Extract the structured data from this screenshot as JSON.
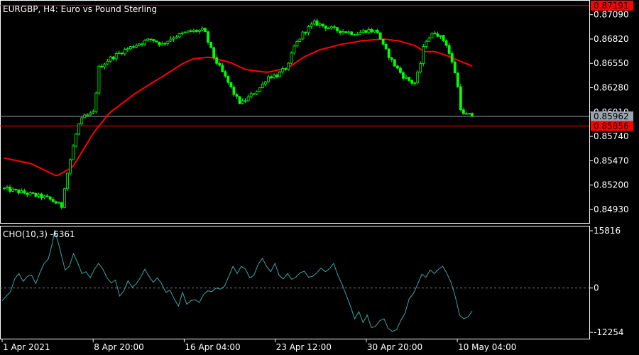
{
  "header": {
    "main_title": "EURGBP, H4:  Euro vs Pound Sterling",
    "indicator_title": "CHO(10,3) -6361"
  },
  "colors": {
    "background": "#000000",
    "bull_candle": "#00ff00",
    "bear_candle": "#00ff00",
    "moving_average": "#ff0000",
    "oscillator": "#3aa6a6",
    "axis_text": "#ffffff",
    "frame": "#ffffff",
    "price_line_bid": "#9aa4ae",
    "level_line": "#ff0000",
    "red_label_bg": "#ff0000",
    "gray_label_bg": "#9aa4ae",
    "zero_line": "#808080"
  },
  "chart_data": [
    {
      "type": "candlestick",
      "title": "EURGBP, H4:  Euro vs Pound Sterling",
      "ylim": [
        0.8478,
        0.87245
      ],
      "y_ticks": [
        "0.87090",
        "0.86820",
        "0.86550",
        "0.86280",
        "0.86010",
        "0.85740",
        "0.85470",
        "0.85200",
        "0.84930"
      ],
      "y_tick_values": [
        0.8709,
        0.8682,
        0.8655,
        0.8628,
        0.8601,
        0.8574,
        0.8547,
        0.852,
        0.8493
      ],
      "x_tick_labels": [
        "1 Apr 2021",
        "8 Apr 20:00",
        "16 Apr 04:00",
        "23 Apr 12:00",
        "30 Apr 20:00",
        "10 May 04:00"
      ],
      "bar_count": 164,
      "close_path": [
        [
          0,
          0.8516
        ],
        [
          8,
          0.8511
        ],
        [
          16,
          0.8506
        ],
        [
          20,
          0.85
        ],
        [
          22,
          0.8496
        ],
        [
          23,
          0.852
        ],
        [
          26,
          0.856
        ],
        [
          28,
          0.8585
        ],
        [
          30,
          0.8595
        ],
        [
          34,
          0.86
        ],
        [
          36,
          0.865
        ],
        [
          40,
          0.866
        ],
        [
          46,
          0.867
        ],
        [
          52,
          0.8678
        ],
        [
          56,
          0.8682
        ],
        [
          60,
          0.8676
        ],
        [
          64,
          0.8684
        ],
        [
          70,
          0.869
        ],
        [
          76,
          0.8692
        ],
        [
          78,
          0.8675
        ],
        [
          80,
          0.866
        ],
        [
          84,
          0.864
        ],
        [
          88,
          0.8618
        ],
        [
          90,
          0.861
        ],
        [
          94,
          0.862
        ],
        [
          98,
          0.863
        ],
        [
          100,
          0.864
        ],
        [
          104,
          0.8642
        ],
        [
          108,
          0.8652
        ],
        [
          110,
          0.8672
        ],
        [
          114,
          0.869
        ],
        [
          118,
          0.87
        ],
        [
          122,
          0.8696
        ],
        [
          126,
          0.8692
        ],
        [
          130,
          0.869
        ],
        [
          134,
          0.8688
        ],
        [
          138,
          0.8692
        ],
        [
          142,
          0.869
        ],
        [
          144,
          0.8675
        ],
        [
          148,
          0.8655
        ],
        [
          152,
          0.864
        ],
        [
          156,
          0.8632
        ],
        [
          158,
          0.865
        ],
        [
          160,
          0.868
        ],
        [
          164,
          0.869
        ],
        [
          168,
          0.8678
        ],
        [
          172,
          0.864
        ],
        [
          174,
          0.8598
        ],
        [
          178,
          0.8597
        ]
      ],
      "noise_amplitude": 0.00035,
      "moving_average": [
        [
          0,
          0.855
        ],
        [
          10,
          0.8544
        ],
        [
          20,
          0.853
        ],
        [
          26,
          0.854
        ],
        [
          34,
          0.8578
        ],
        [
          40,
          0.86
        ],
        [
          50,
          0.8622
        ],
        [
          60,
          0.864
        ],
        [
          68,
          0.8655
        ],
        [
          72,
          0.866
        ],
        [
          78,
          0.8662
        ],
        [
          86,
          0.8656
        ],
        [
          92,
          0.8648
        ],
        [
          100,
          0.8645
        ],
        [
          108,
          0.865
        ],
        [
          114,
          0.8662
        ],
        [
          120,
          0.867
        ],
        [
          128,
          0.8676
        ],
        [
          136,
          0.868
        ],
        [
          144,
          0.8682
        ],
        [
          150,
          0.868
        ],
        [
          156,
          0.8675
        ],
        [
          160,
          0.8668
        ],
        [
          164,
          0.8668
        ],
        [
          168,
          0.8664
        ],
        [
          178,
          0.8652
        ]
      ],
      "levels": [
        {
          "label": "0.87191",
          "value": 0.87191,
          "style": "red"
        },
        {
          "label": "0.85962",
          "value": 0.85962,
          "style": "gray"
        },
        {
          "label": "0.85856",
          "value": 0.85856,
          "style": "red"
        }
      ]
    },
    {
      "type": "line",
      "title": "CHO(10,3) -6361",
      "ylim": [
        -14000,
        17000
      ],
      "y_ticks": [
        "15816",
        "0",
        "-12254"
      ],
      "y_tick_values": [
        15816,
        0,
        -12254
      ],
      "zero_line": true,
      "values": [
        [
          0,
          -3500
        ],
        [
          4,
          -1000
        ],
        [
          6,
          2500
        ],
        [
          8,
          4000
        ],
        [
          10,
          1800
        ],
        [
          12,
          3200
        ],
        [
          14,
          3600
        ],
        [
          16,
          1200
        ],
        [
          18,
          4200
        ],
        [
          20,
          6800
        ],
        [
          22,
          8000
        ],
        [
          24,
          12500
        ],
        [
          25,
          16000
        ],
        [
          27,
          12000
        ],
        [
          30,
          5000
        ],
        [
          32,
          6000
        ],
        [
          34,
          9500
        ],
        [
          36,
          7000
        ],
        [
          38,
          4000
        ],
        [
          40,
          4500
        ],
        [
          42,
          2800
        ],
        [
          44,
          5200
        ],
        [
          46,
          6800
        ],
        [
          48,
          5200
        ],
        [
          50,
          2800
        ],
        [
          52,
          1400
        ],
        [
          54,
          2200
        ],
        [
          56,
          -2200
        ],
        [
          58,
          -800
        ],
        [
          60,
          2000
        ],
        [
          62,
          200
        ],
        [
          64,
          1200
        ],
        [
          66,
          3000
        ],
        [
          68,
          5200
        ],
        [
          70,
          3200
        ],
        [
          72,
          1600
        ],
        [
          74,
          2800
        ],
        [
          76,
          1200
        ],
        [
          78,
          -1200
        ],
        [
          80,
          -600
        ],
        [
          82,
          -3000
        ],
        [
          84,
          -5000
        ],
        [
          86,
          -1200
        ],
        [
          88,
          -4500
        ],
        [
          90,
          -3500
        ],
        [
          92,
          -3200
        ],
        [
          94,
          -4000
        ],
        [
          96,
          -1800
        ],
        [
          98,
          -800
        ],
        [
          100,
          -1000
        ],
        [
          102,
          0
        ],
        [
          104,
          -300
        ],
        [
          106,
          500
        ],
        [
          108,
          3200
        ],
        [
          110,
          6000
        ],
        [
          112,
          4000
        ],
        [
          114,
          6000
        ],
        [
          116,
          5200
        ],
        [
          118,
          2800
        ],
        [
          120,
          3500
        ],
        [
          122,
          6500
        ],
        [
          124,
          8200
        ],
        [
          126,
          6000
        ],
        [
          128,
          4500
        ],
        [
          130,
          6800
        ],
        [
          132,
          3500
        ],
        [
          134,
          2500
        ],
        [
          136,
          4000
        ],
        [
          138,
          2400
        ],
        [
          140,
          3000
        ],
        [
          142,
          4200
        ],
        [
          144,
          4600
        ],
        [
          146,
          3000
        ],
        [
          148,
          3200
        ],
        [
          150,
          4200
        ],
        [
          152,
          5500
        ],
        [
          154,
          4500
        ],
        [
          156,
          5300
        ],
        [
          158,
          6800
        ],
        [
          160,
          3500
        ],
        [
          162,
          1000
        ],
        [
          164,
          -2000
        ],
        [
          166,
          -5000
        ],
        [
          168,
          -8500
        ],
        [
          170,
          -6500
        ],
        [
          172,
          -9500
        ],
        [
          174,
          -7500
        ],
        [
          176,
          -11000
        ],
        [
          178,
          -10500
        ],
        [
          180,
          -9000
        ],
        [
          182,
          -8500
        ],
        [
          184,
          -11200
        ],
        [
          186,
          -12000
        ],
        [
          188,
          -11500
        ],
        [
          190,
          -9000
        ],
        [
          192,
          -7000
        ],
        [
          194,
          -3000
        ],
        [
          196,
          -1500
        ],
        [
          198,
          1000
        ],
        [
          200,
          3800
        ],
        [
          202,
          3000
        ],
        [
          204,
          5000
        ],
        [
          206,
          4000
        ],
        [
          208,
          5200
        ],
        [
          210,
          6000
        ],
        [
          212,
          4000
        ],
        [
          214,
          1500
        ],
        [
          216,
          -2500
        ],
        [
          218,
          -7500
        ],
        [
          220,
          -8500
        ],
        [
          222,
          -8000
        ],
        [
          224,
          -6361
        ]
      ]
    }
  ]
}
